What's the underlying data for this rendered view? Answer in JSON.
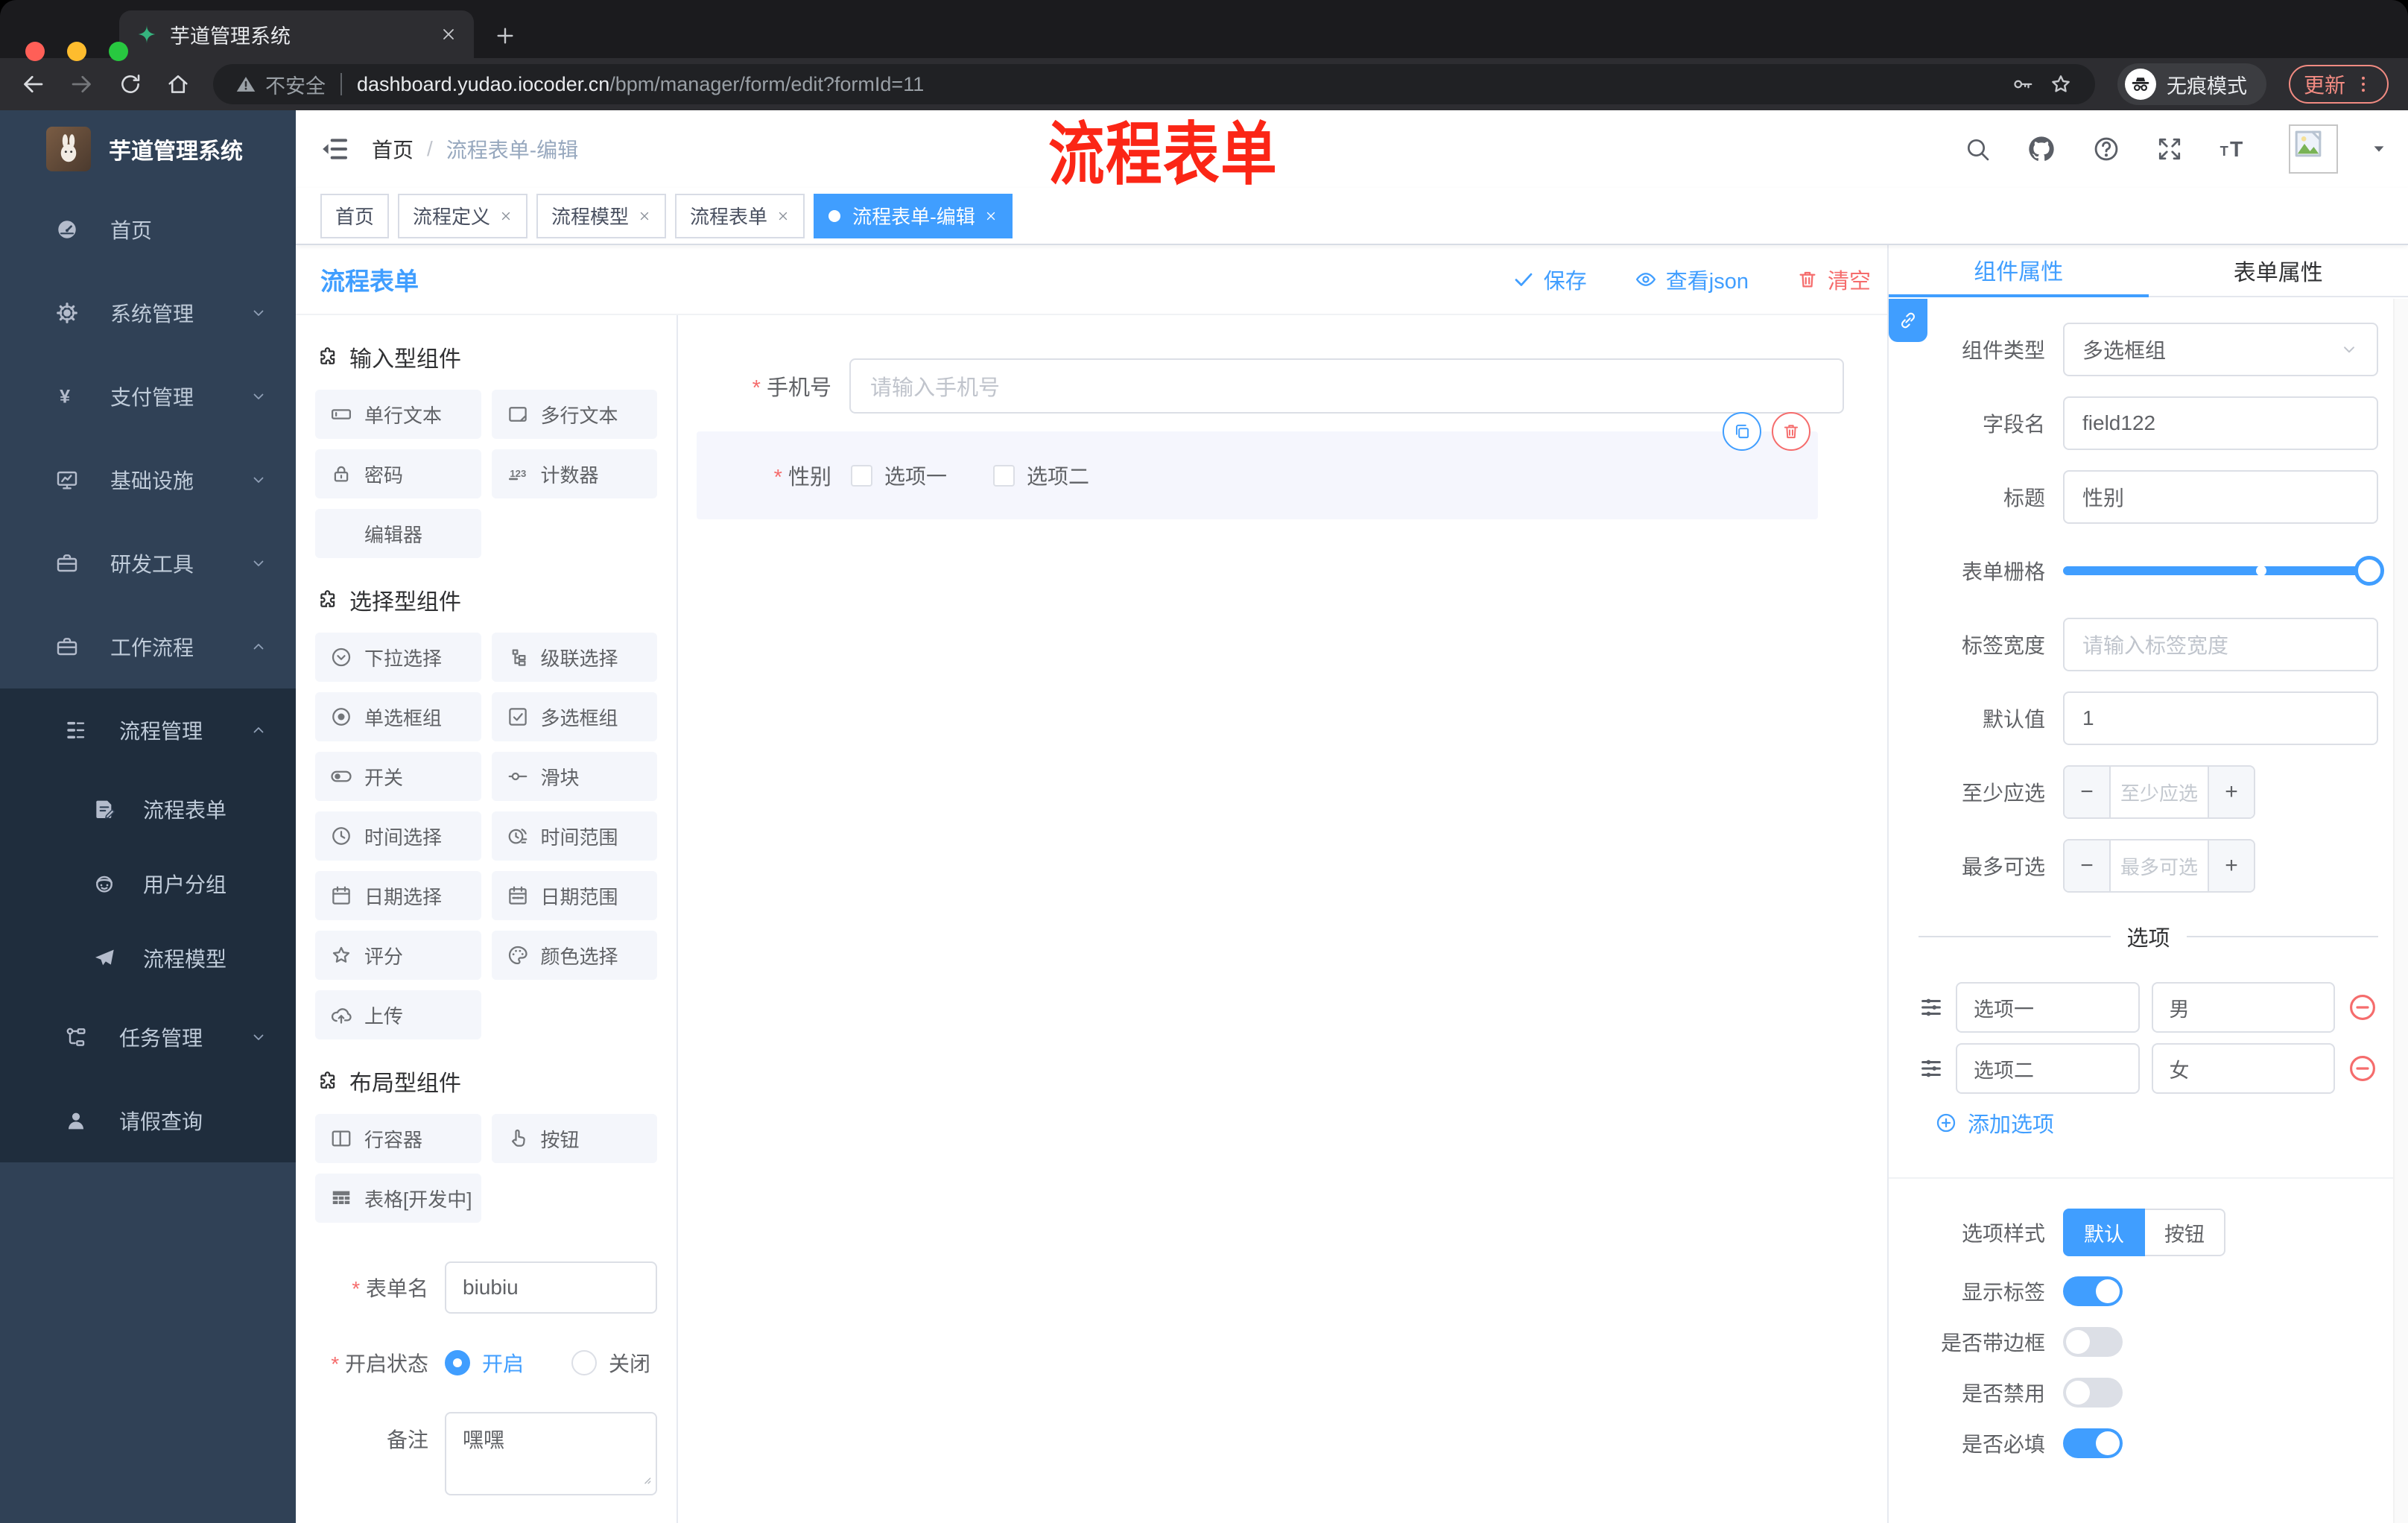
{
  "colors": {
    "accent": "#409EFF",
    "danger": "#F56C6C",
    "annotation_red": "#FB2616",
    "sidebar_bg": "#304156",
    "submenu_bg": "#1F2D3D",
    "active_tag": "#409EFF"
  },
  "browser": {
    "tab_title": "芋道管理系统",
    "security_label": "不安全",
    "url_domain": "dashboard.yudao.iocoder.cn",
    "url_path": "/bpm/manager/form/edit?formId=11",
    "incognito_label": "无痕模式",
    "update_label": "更新"
  },
  "sidebar": {
    "logo_title": "芋道管理系统",
    "items": [
      {
        "label": "首页",
        "icon": "dashboard",
        "chevron": "",
        "level": 0,
        "dark": false
      },
      {
        "label": "系统管理",
        "icon": "gear",
        "chevron": "down",
        "level": 0,
        "dark": false
      },
      {
        "label": "支付管理",
        "icon": "yen",
        "chevron": "down",
        "level": 0,
        "dark": false
      },
      {
        "label": "基础设施",
        "icon": "monitor",
        "chevron": "down",
        "level": 0,
        "dark": false
      },
      {
        "label": "研发工具",
        "icon": "briefcase",
        "chevron": "down",
        "level": 0,
        "dark": false
      },
      {
        "label": "工作流程",
        "icon": "briefcase",
        "chevron": "up",
        "level": 0,
        "dark": false
      },
      {
        "label": "流程管理",
        "icon": "treelist",
        "chevron": "up",
        "level": 1,
        "dark": true
      },
      {
        "label": "流程表单",
        "icon": "docedit",
        "chevron": "",
        "level": 2,
        "dark": true
      },
      {
        "label": "用户分组",
        "icon": "face",
        "chevron": "",
        "level": 2,
        "dark": true
      },
      {
        "label": "流程模型",
        "icon": "plane",
        "chevron": "",
        "level": 2,
        "dark": true
      },
      {
        "label": "任务管理",
        "icon": "flow",
        "chevron": "down",
        "level": 1,
        "dark": true
      },
      {
        "label": "请假查询",
        "icon": "person",
        "chevron": "",
        "level": 1,
        "dark": true
      }
    ]
  },
  "header": {
    "breadcrumb": [
      "首页",
      "流程表单-编辑"
    ],
    "annotation": "流程表单"
  },
  "tags": [
    {
      "label": "首页",
      "closable": false,
      "active": false
    },
    {
      "label": "流程定义",
      "closable": true,
      "active": false
    },
    {
      "label": "流程模型",
      "closable": true,
      "active": false
    },
    {
      "label": "流程表单",
      "closable": true,
      "active": false
    },
    {
      "label": "流程表单-编辑",
      "closable": true,
      "active": true
    }
  ],
  "designer": {
    "title": "流程表单",
    "actions": [
      {
        "label": "保存",
        "icon": "check",
        "type": "primary"
      },
      {
        "label": "查看json",
        "icon": "eye",
        "type": "primary"
      },
      {
        "label": "清空",
        "icon": "trash",
        "type": "danger"
      }
    ],
    "palette": {
      "groups": [
        {
          "title": "输入型组件",
          "items": [
            {
              "label": "单行文本",
              "icon": "input"
            },
            {
              "label": "多行文本",
              "icon": "textarea"
            },
            {
              "label": "密码",
              "icon": "lock"
            },
            {
              "label": "计数器",
              "icon": "counter"
            },
            {
              "label": "编辑器",
              "icon": ""
            }
          ]
        },
        {
          "title": "选择型组件",
          "items": [
            {
              "label": "下拉选择",
              "icon": "select"
            },
            {
              "label": "级联选择",
              "icon": "cascade"
            },
            {
              "label": "单选框组",
              "icon": "radio"
            },
            {
              "label": "多选框组",
              "icon": "checkbox"
            },
            {
              "label": "开关",
              "icon": "switch"
            },
            {
              "label": "滑块",
              "icon": "sliderline"
            },
            {
              "label": "时间选择",
              "icon": "time"
            },
            {
              "label": "时间范围",
              "icon": "timerange"
            },
            {
              "label": "日期选择",
              "icon": "date"
            },
            {
              "label": "日期范围",
              "icon": "daterange"
            },
            {
              "label": "评分",
              "icon": "star"
            },
            {
              "label": "颜色选择",
              "icon": "palette"
            },
            {
              "label": "上传",
              "icon": "upload"
            }
          ]
        },
        {
          "title": "布局型组件",
          "items": [
            {
              "label": "行容器",
              "icon": "rowcol"
            },
            {
              "label": "按钮",
              "icon": "pointer"
            },
            {
              "label": "表格[开发中]",
              "icon": "tablegrid"
            }
          ]
        }
      ]
    },
    "meta": {
      "form_name_label": "表单名",
      "form_name_value": "biubiu",
      "status_label": "开启状态",
      "status_options": [
        "开启",
        "关闭"
      ],
      "status_selected": "开启",
      "remark_label": "备注",
      "remark_value": "嘿嘿"
    },
    "canvas": {
      "phone_label": "手机号",
      "phone_placeholder": "请输入手机号",
      "gender_label": "性别",
      "gender_options": [
        "选项一",
        "选项二"
      ]
    }
  },
  "inspector": {
    "tabs": [
      "组件属性",
      "表单属性"
    ],
    "active_tab": "组件属性",
    "component_type_label": "组件类型",
    "component_type_value": "多选框组",
    "field_name_label": "字段名",
    "field_name_value": "field122",
    "title_label": "标题",
    "title_value": "性别",
    "grid_label": "表单栅格",
    "label_width_label": "标签宽度",
    "label_width_placeholder": "请输入标签宽度",
    "default_label": "默认值",
    "default_value": "1",
    "min_label": "至少应选",
    "min_placeholder": "至少应选",
    "max_label": "最多可选",
    "max_placeholder": "最多可选",
    "options_title": "选项",
    "options": [
      {
        "name": "选项一",
        "value": "男"
      },
      {
        "name": "选项二",
        "value": "女"
      }
    ],
    "add_option_label": "添加选项",
    "style_label": "选项样式",
    "style_options": [
      "默认",
      "按钮"
    ],
    "style_selected": "默认",
    "toggles": [
      {
        "label": "显示标签",
        "on": true
      },
      {
        "label": "是否带边框",
        "on": false
      },
      {
        "label": "是否禁用",
        "on": false
      },
      {
        "label": "是否必填",
        "on": true
      }
    ]
  }
}
